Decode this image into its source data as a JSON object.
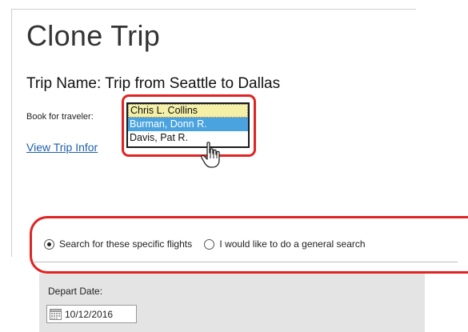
{
  "page": {
    "title": "Clone Trip",
    "trip_name": "Trip Name: Trip from Seattle to Dallas"
  },
  "traveler": {
    "label": "Book for traveler:",
    "options": [
      {
        "label": "Chris L. Collins",
        "state": "selected"
      },
      {
        "label": "Burman, Donn R.",
        "state": "hover"
      },
      {
        "label": "Davis, Pat R.",
        "state": "normal"
      }
    ]
  },
  "links": {
    "view_trip": "View Trip Infor"
  },
  "search_type": {
    "options": [
      {
        "label": "Search for these specific flights",
        "checked": true
      },
      {
        "label": "I would like to do a general search",
        "checked": false
      }
    ]
  },
  "depart": {
    "label": "Depart Date:",
    "value": "10/12/2016"
  },
  "colors": {
    "highlight_red": "#e02424",
    "link_blue": "#1f5fa8",
    "hover_blue": "#4aa3df",
    "selected_yellow": "#f5f0a8",
    "panel_gray": "#e4e4e4"
  },
  "icons": {
    "cursor": "hand-pointer-icon",
    "calendar": "calendar-icon"
  }
}
